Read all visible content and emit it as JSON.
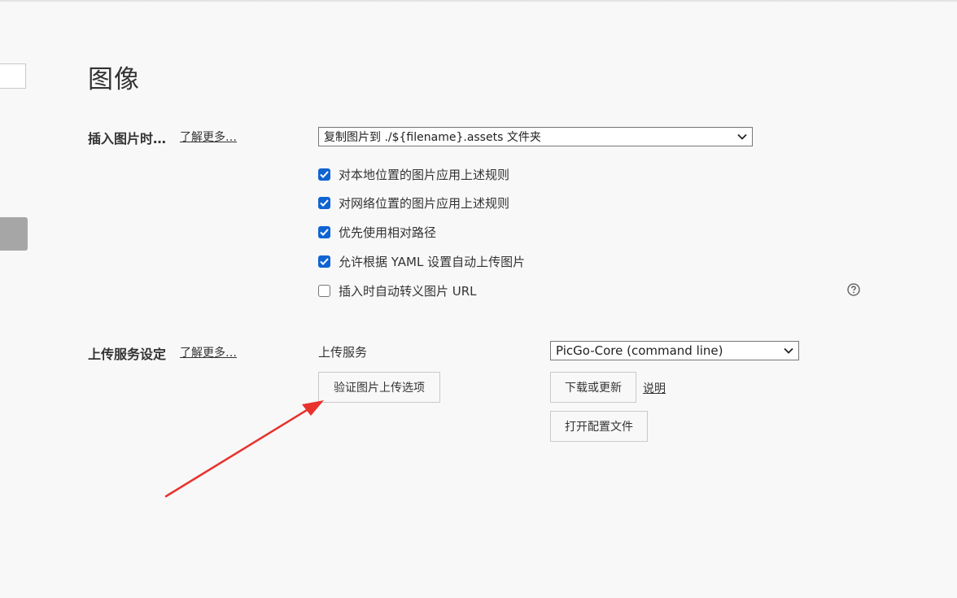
{
  "page": {
    "title": "图像"
  },
  "insert_section": {
    "label": "插入图片时…",
    "learn_more": "了解更多…",
    "select_value": "复制图片到 ./${filename}.assets 文件夹",
    "options": [
      {
        "label": "对本地位置的图片应用上述规则",
        "checked": true
      },
      {
        "label": "对网络位置的图片应用上述规则",
        "checked": true
      },
      {
        "label": "优先使用相对路径",
        "checked": true
      },
      {
        "label": "允许根据 YAML 设置自动上传图片",
        "checked": true
      },
      {
        "label": "插入时自动转义图片 URL",
        "checked": false
      }
    ],
    "help_icon": "question-circle-icon"
  },
  "upload_section": {
    "label": "上传服务设定",
    "learn_more": "了解更多…",
    "service_label": "上传服务",
    "service_select_value": "PicGo-Core (command line)",
    "verify_button": "验证图片上传选项",
    "download_button": "下载或更新",
    "explain_link": "说明",
    "open_config_button": "打开配置文件"
  },
  "colors": {
    "background": "#f8f8f8",
    "checkbox_checked": "#0f64d2",
    "annotation_arrow": "#e8322d"
  }
}
